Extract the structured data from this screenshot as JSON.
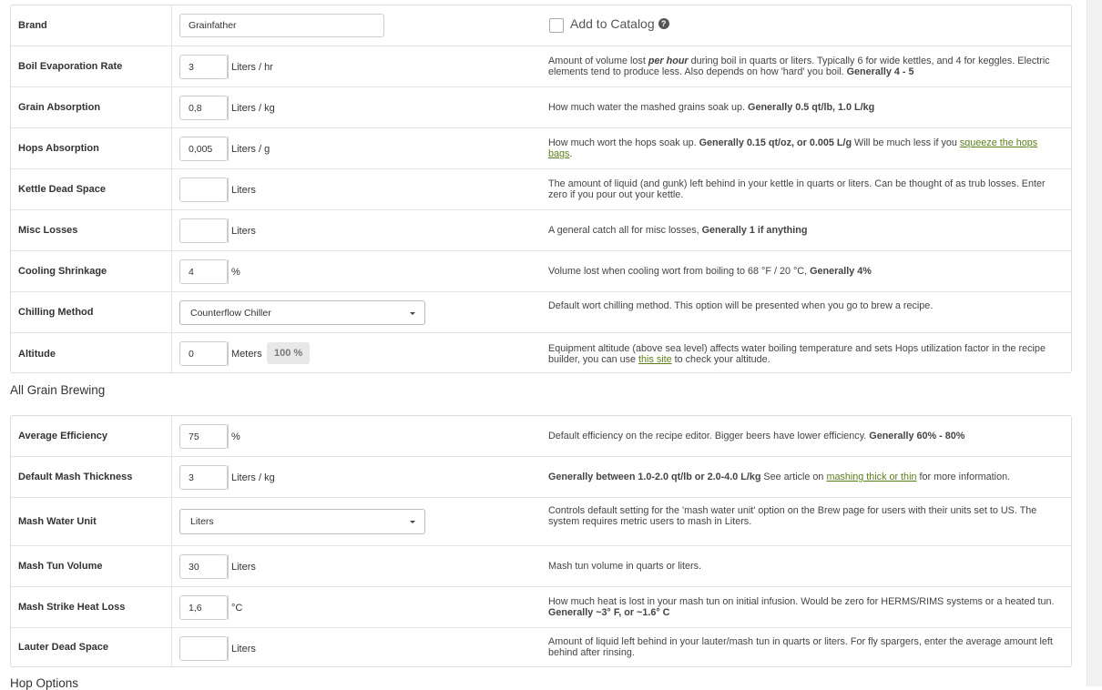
{
  "equipment": {
    "brand": {
      "label": "Brand",
      "value": "Grainfather"
    },
    "add_to_catalog": {
      "label": "Add to Catalog",
      "icon": "question-circle-icon"
    },
    "boil_evaporation": {
      "label": "Boil Evaporation Rate",
      "value": "3",
      "unit": "Liters / hr",
      "desc_a": "Amount of volume lost ",
      "desc_b": "per hour",
      "desc_c": " during boil in quarts or liters. Typically 6 for wide kettles, and 4 for keggles. Electric elements tend to produce less. Also depends on how 'hard' you boil. ",
      "desc_d": "Generally 4 - 5"
    },
    "grain_absorption": {
      "label": "Grain Absorption",
      "value": "0,8",
      "unit": "Liters / kg",
      "desc_a": "How much water the mashed grains soak up. ",
      "desc_b": "Generally 0.5 qt/lb, 1.0 L/kg"
    },
    "hops_absorption": {
      "label": "Hops Absorption",
      "value": "0,005",
      "unit": "Liters / g",
      "desc_a": "How much wort the hops soak up. ",
      "desc_b": "Generally 0.15 qt/oz, or 0.005 L/g",
      "desc_c": " Will be much less if you ",
      "link": "squeeze the hops bags",
      "desc_d": "."
    },
    "kettle_dead_space": {
      "label": "Kettle Dead Space",
      "value": "",
      "unit": "Liters",
      "desc": "The amount of liquid (and gunk) left behind in your kettle in quarts or liters. Can be thought of as trub losses. Enter zero if you pour out your kettle."
    },
    "misc_losses": {
      "label": "Misc Losses",
      "value": "",
      "unit": "Liters",
      "desc_a": "A general catch all for misc losses, ",
      "desc_b": "Generally 1 if anything"
    },
    "cooling_shrinkage": {
      "label": "Cooling Shrinkage",
      "value": "4",
      "unit": "%",
      "desc_a": "Volume lost when cooling wort from boiling to 68 °F / 20 °C, ",
      "desc_b": "Generally 4%"
    },
    "chilling_method": {
      "label": "Chilling Method",
      "value": "Counterflow Chiller",
      "desc": "Default wort chilling method. This option will be presented when you go to brew a recipe."
    },
    "altitude": {
      "label": "Altitude",
      "value": "0",
      "unit": "Meters",
      "badge": "100 %",
      "desc_a": "Equipment altitude (above sea level) affects water boiling temperature and sets Hops utilization factor in the recipe builder, you can use ",
      "link": "this site",
      "desc_b": " to check your altitude."
    }
  },
  "all_grain": {
    "title": "All Grain Brewing",
    "average_efficiency": {
      "label": "Average Efficiency",
      "value": "75",
      "unit": "%",
      "desc_a": "Default efficiency on the recipe editor. Bigger beers have lower efficiency. ",
      "desc_b": "Generally 60% - 80%"
    },
    "mash_thickness": {
      "label": "Default Mash Thickness",
      "value": "3",
      "unit": "Liters / kg",
      "desc_a": "Generally between 1.0-2.0 qt/lb or 2.0-4.0 L/kg",
      "desc_b": " See article on ",
      "link": "mashing thick or thin",
      "desc_c": " for more information."
    },
    "mash_water_unit": {
      "label": "Mash Water Unit",
      "value": "Liters",
      "desc": "Controls default setting for the 'mash water unit' option on the Brew page for users with their units set to US. The system requires metric users to mash in Liters."
    },
    "mash_tun_volume": {
      "label": "Mash Tun Volume",
      "value": "30",
      "unit": "Liters",
      "desc": "Mash tun volume in quarts or liters."
    },
    "mash_strike_heat_loss": {
      "label": "Mash Strike Heat Loss",
      "value": "1,6",
      "unit": "°C",
      "desc_a": "How much heat is lost in your mash tun on initial infusion. Would be zero for HERMS/RIMS systems or a heated tun. ",
      "desc_b": "Generally ~3° F, or ~1.6° C"
    },
    "lauter_dead_space": {
      "label": "Lauter Dead Space",
      "value": "",
      "unit": "Liters",
      "desc": "Amount of liquid left behind in your lauter/mash tun in quarts or liters. For fly spargers, enter the average amount left behind after rinsing."
    }
  },
  "hop_options": {
    "title": "Hop Options"
  }
}
